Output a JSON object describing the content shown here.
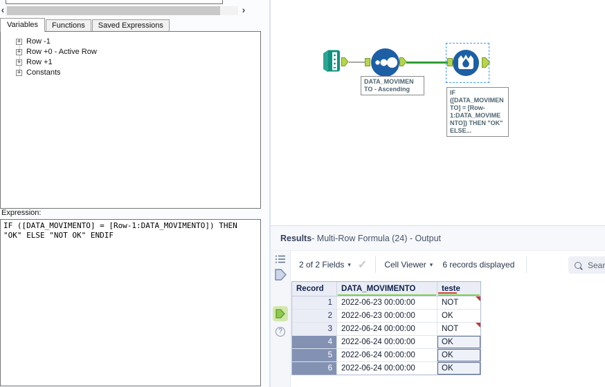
{
  "left_panel": {
    "scrollbar": {
      "left_arrow": "‹",
      "right_arrow": "›"
    },
    "tabs": [
      {
        "label": "Variables",
        "active": true
      },
      {
        "label": "Functions",
        "active": false
      },
      {
        "label": "Saved Expressions",
        "active": false
      }
    ],
    "tree": {
      "expander_glyph": "+",
      "items": [
        {
          "label": "Row -1"
        },
        {
          "label": "Row +0 - Active Row"
        },
        {
          "label": "Row +1"
        },
        {
          "label": "Constants"
        }
      ]
    },
    "expression": {
      "label": "Expression:",
      "value": "IF ([DATA_MOVIMENTO] = [Row-1:DATA_MOVIMENTO]) THEN\n\"OK\" ELSE \"NOT OK\" ENDIF"
    }
  },
  "canvas": {
    "tools": [
      {
        "id": "input-data",
        "type": "Input Data",
        "annotation": ""
      },
      {
        "id": "sort",
        "type": "Sort",
        "annotation": "DATA_MOVIMEN\nTO - Ascending"
      },
      {
        "id": "multi-row-formula",
        "type": "Multi-Row Formula",
        "selected": true,
        "annotation": "IF\n([DATA_MOVIMEN\nTO] = [Row-\n1:DATA_MOVIME\nNTO]) THEN \"OK\"\nELSE..."
      }
    ]
  },
  "results": {
    "title": {
      "bold": "Results",
      "rest": " - Multi-Row Formula (24) - Output"
    },
    "toolbar": {
      "fields_dropdown": "2 of 2 Fields",
      "cell_viewer_dropdown": "Cell Viewer",
      "records_text": "6 records displayed",
      "search_placeholder": "Search"
    },
    "table": {
      "columns": [
        {
          "name": "Record",
          "underline": "none"
        },
        {
          "name": "DATA_MOVIMENTO",
          "underline": "green"
        },
        {
          "name": "teste",
          "underline": "red-green"
        }
      ],
      "rows": [
        {
          "record": "1",
          "data": "2022-06-23 00:00:00",
          "teste": "NOT",
          "flag": true,
          "selected": false
        },
        {
          "record": "2",
          "data": "2022-06-23 00:00:00",
          "teste": "OK",
          "flag": false,
          "selected": false
        },
        {
          "record": "3",
          "data": "2022-06-24 00:00:00",
          "teste": "NOT",
          "flag": true,
          "selected": false
        },
        {
          "record": "4",
          "data": "2022-06-24 00:00:00",
          "teste": "OK",
          "flag": false,
          "selected": true
        },
        {
          "record": "5",
          "data": "2022-06-24 00:00:00",
          "teste": "OK",
          "flag": false,
          "selected": true
        },
        {
          "record": "6",
          "data": "2022-06-24 00:00:00",
          "teste": "OK",
          "flag": false,
          "selected": true
        }
      ]
    }
  },
  "icons": {
    "caret": "▾",
    "check": "✓",
    "help": "?"
  },
  "colors": {
    "tool_blue": "#1d5fa5",
    "tool_teal": "#0e9180",
    "anchor_green": "#b7d44e",
    "wire_green": "#2f9e33",
    "wire_gray": "#a8a8a8",
    "selection_blue": "#3d9bf5",
    "selected_row_bg": "#8392b3",
    "flag_red": "#c3392b",
    "underline_green": "#7ed04e",
    "underline_red": "#d23b2f"
  }
}
